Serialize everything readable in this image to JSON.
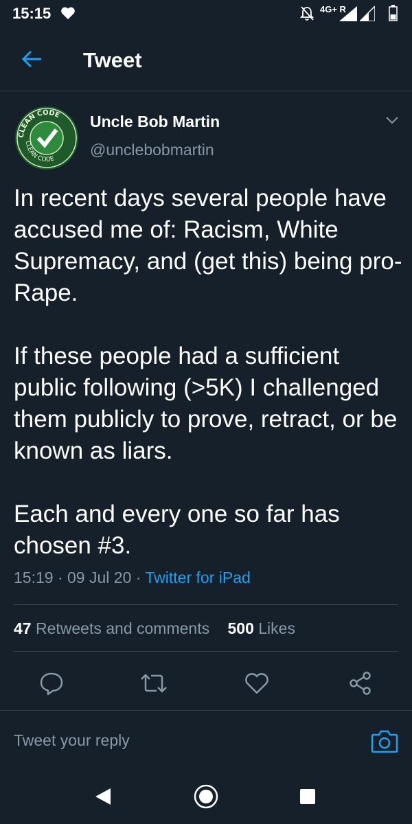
{
  "status_bar": {
    "time": "15:15",
    "network": "4G+ R",
    "icons": [
      "heart-icon",
      "bell-off-icon",
      "signal-icon",
      "signal-icon",
      "battery-icon"
    ]
  },
  "header": {
    "title": "Tweet",
    "back_icon": "arrow-left-icon",
    "accent": "#1da1f2"
  },
  "author": {
    "name": "Uncle Bob Martin",
    "handle": "@unclebobmartin",
    "avatar_text_top": "CLEAN CODE",
    "avatar_text_bottom": "CLEAN CODE"
  },
  "tweet": {
    "paragraphs": [
      "In recent days several people have accused me of: Racism, White Supremacy, and (get this) being pro-Rape.",
      "If these people had a sufficient public following (>5K) I challenged them publicly to prove, retract, or be known as liars.",
      "Each and every one so far has chosen #3."
    ],
    "time": "15:19",
    "date": "09 Jul 20",
    "source": "Twitter for iPad"
  },
  "stats": {
    "retweets_count": "47",
    "retweets_label": "Retweets and comments",
    "likes_count": "500",
    "likes_label": "Likes"
  },
  "actions": [
    "reply-icon",
    "retweet-icon",
    "like-icon",
    "share-icon"
  ],
  "reply": {
    "placeholder": "Tweet your reply",
    "camera_icon": "camera-icon"
  },
  "nav": [
    "back-triangle-icon",
    "home-circle-icon",
    "recents-square-icon"
  ]
}
